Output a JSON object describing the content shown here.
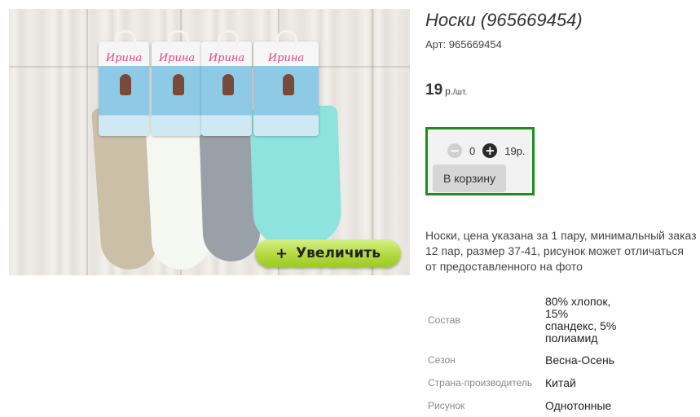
{
  "product": {
    "title": "Носки (965669454)",
    "article": "Арт: 965669454",
    "price_value": "19",
    "price_unit": "р.",
    "price_per": "/шт."
  },
  "image": {
    "brand": "Ирина",
    "zoom_icon": "plus-icon",
    "zoom_label": "Увеличить",
    "sock_colors": [
      "#cbbfa8",
      "#f5f7f1",
      "#9aa0a8",
      "#8fe3de"
    ]
  },
  "cart": {
    "quantity": "0",
    "sum": "19р.",
    "add_label": "В корзину",
    "minus_icon": "minus-icon",
    "plus_icon": "plus-icon",
    "border_color": "#1e8f1e"
  },
  "description": [
    "Носки, цена указана за 1 пару, минимальный заказ",
    "12 пар, размер 37-41, рисунок может отличаться",
    "от предоставленного на фото"
  ],
  "properties": [
    {
      "key": "Состав",
      "value_lines": [
        "80% хлопок,",
        "15%",
        "спандекс, 5%",
        "полиамид"
      ]
    },
    {
      "key": "Сезон",
      "value_lines": [
        "Весна-Осень"
      ]
    },
    {
      "key": "Страна-производитель",
      "value_lines": [
        "Китай"
      ]
    },
    {
      "key": "Рисунок",
      "value_lines": [
        "Однотонные"
      ]
    }
  ]
}
